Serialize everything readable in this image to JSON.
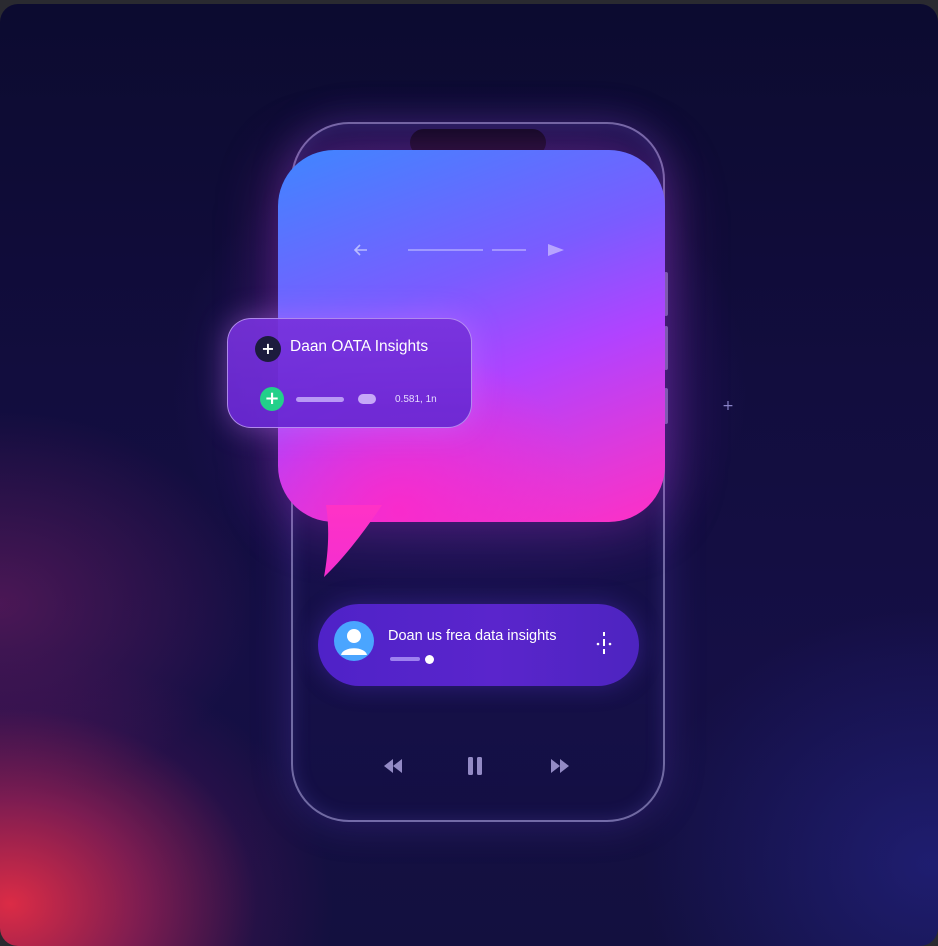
{
  "card": {
    "title": "Daan OATA Insights",
    "meta": "0.581, 1n",
    "add_icon": "plus-circle-dark-icon",
    "action_icon": "plus-circle-green-icon",
    "action_color": "#23d08a"
  },
  "message": {
    "text": "Doan us frea data insights",
    "avatar_icon": "user-avatar-icon",
    "action_icon": "microphone-icon"
  },
  "bubble": {
    "icons": [
      "arrow-left-icon",
      "arrow-right-icon"
    ]
  },
  "controls": {
    "icons": [
      "rewind-icon",
      "pause-icon",
      "fast-forward-icon"
    ]
  },
  "colors": {
    "background": "#120d3e",
    "bubble_start": "#3f86ff",
    "bubble_end": "#ff2fc5",
    "pill": "#5a25cc",
    "card": "#7832dc"
  }
}
